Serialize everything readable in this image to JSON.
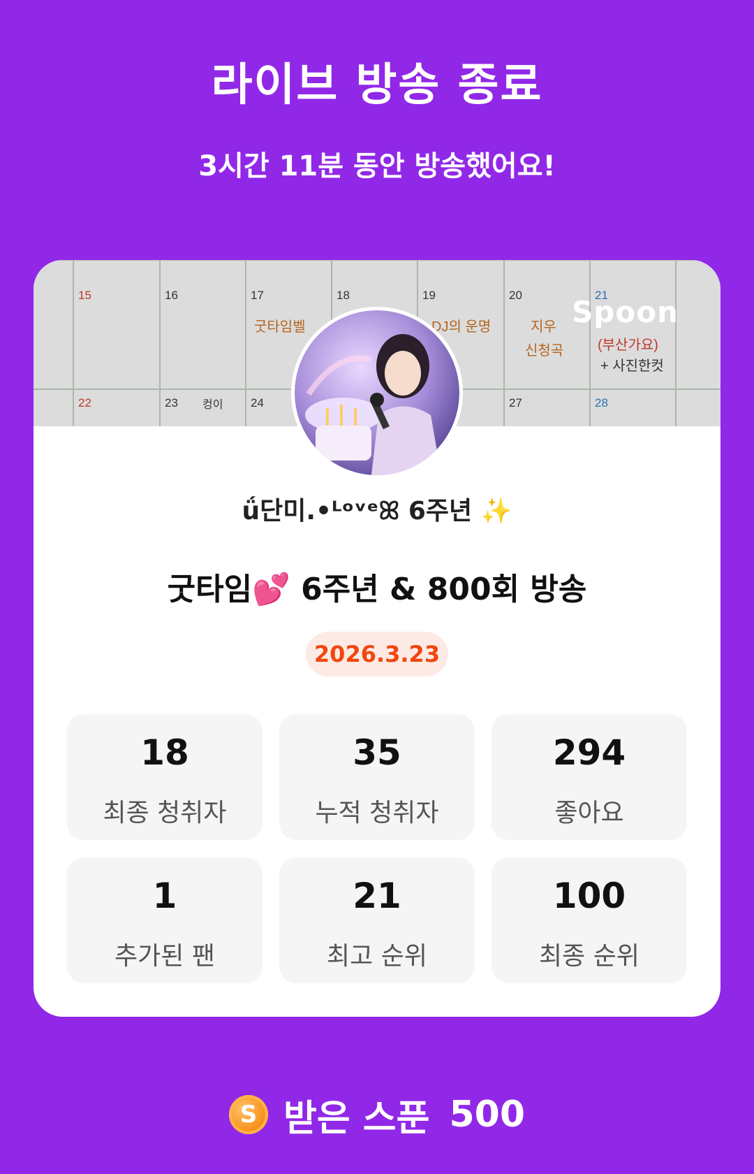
{
  "header": {
    "title": "라이브 방송 종료",
    "duration_text": "3시간 11분 동안 방송했어요!"
  },
  "card": {
    "brand": "Spoon",
    "dj_name": "ǘ단미.•ᴸᵒᵛᵉꕤ 6주년 ✨",
    "broadcast_title": "굿타임💕 6주년 & 800회 방송",
    "date": "2026.3.23",
    "calendar_days": [
      "15",
      "16",
      "17",
      "18",
      "19",
      "20",
      "21",
      "22",
      "23",
      "24",
      "27",
      "28"
    ],
    "calendar_notes": [
      "굿타임벨",
      "DJ의 운명",
      "지우",
      "신청곡",
      "(부산가요)",
      "+ 사진한컷",
      "컹이"
    ],
    "stats": [
      {
        "value": "18",
        "label": "최종 청취자"
      },
      {
        "value": "35",
        "label": "누적 청취자"
      },
      {
        "value": "294",
        "label": "좋아요"
      },
      {
        "value": "1",
        "label": "추가된 팬"
      },
      {
        "value": "21",
        "label": "최고 순위"
      },
      {
        "value": "100",
        "label": "최종 순위"
      }
    ]
  },
  "footer": {
    "coin_icon": "S",
    "label": "받은 스푼",
    "count": "500"
  },
  "colors": {
    "background": "#9128e8",
    "date_text": "#f0470e",
    "date_bg": "#fdeae4",
    "coin": "#f7951e"
  }
}
